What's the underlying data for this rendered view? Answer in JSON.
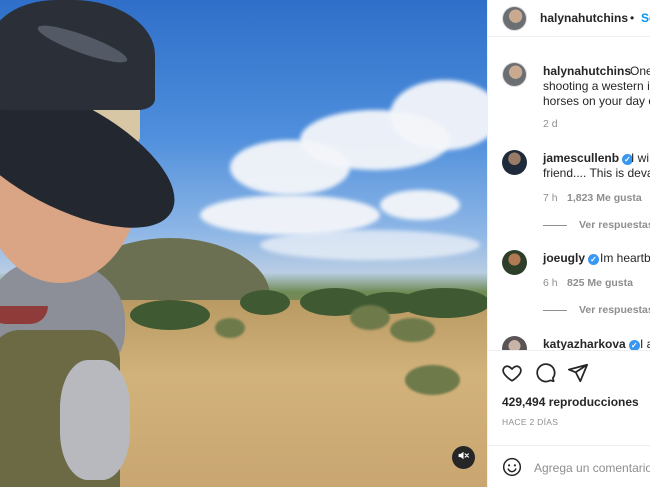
{
  "post": {
    "author": "halynahutchins",
    "follow_label": "Se",
    "separator": "•",
    "caption_lines": [
      "One",
      "shooting a western is",
      "horses on your day o"
    ],
    "caption_age": "2 d"
  },
  "comments": [
    {
      "username": "jamescullenb",
      "verified": true,
      "lines": [
        "I wi",
        "friend.... This is deva"
      ],
      "age": "7 h",
      "likes": "1,823 Me gusta",
      "replies_label": "Ver respuestas"
    },
    {
      "username": "joeugly",
      "verified": true,
      "lines": [
        "Im heartb"
      ],
      "age": "6 h",
      "likes": "825 Me gusta",
      "replies_label": "Ver respuestas"
    },
    {
      "username": "katyazharkova",
      "verified": true,
      "lines": [
        "I a"
      ]
    }
  ],
  "stats": {
    "views": "429,494 reproducciones",
    "posted": "HACE 2 DÍAS"
  },
  "comment_box": {
    "placeholder": "Agrega un comentario"
  },
  "icons": {
    "like": "heart-icon",
    "comment": "comment-icon",
    "share": "paper-plane-icon",
    "emoji": "emoji-icon",
    "mute": "muted-speaker-icon",
    "verified": "verified-badge-icon"
  },
  "colors": {
    "link_blue": "#0095f6",
    "verified_blue": "#3897f0",
    "muted_text": "#8e8e8e"
  }
}
